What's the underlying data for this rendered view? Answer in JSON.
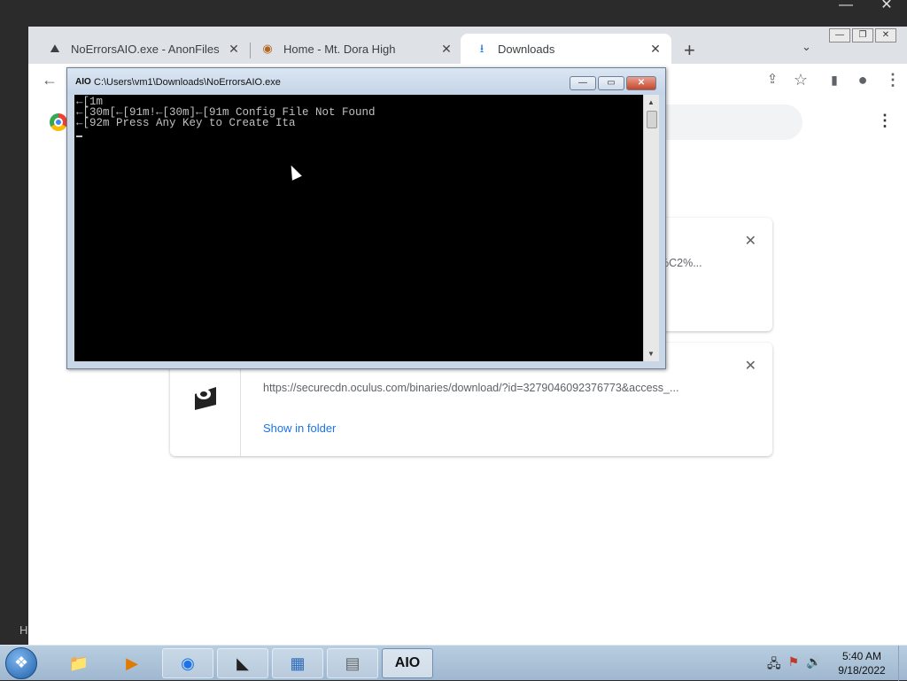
{
  "desktop": {
    "outer_minimize": "—",
    "outer_close": "✕",
    "edge_letter": "H"
  },
  "browser": {
    "tabs": [
      {
        "title": "NoErrorsAIO.exe - AnonFiles",
        "icon": "anonfiles-icon",
        "close": "✕"
      },
      {
        "title": "Home - Mt. Dora High",
        "icon": "mtdora-icon",
        "close": "✕"
      },
      {
        "title": "Downloads",
        "icon": "download-icon",
        "close": "✕"
      }
    ],
    "new_tab": "+",
    "tab_search": "⌄",
    "window_controls": {
      "minimize": "—",
      "restore": "❐",
      "close": "✕"
    },
    "toolbar": {
      "back": "←",
      "share": "⇪",
      "bookmark": "☆",
      "sidebar": "▮",
      "profile": "●",
      "menu": "⋮"
    },
    "downloads_menu": "⋮"
  },
  "downloads": [
    {
      "url": "%C2%...",
      "close": "✕"
    },
    {
      "url": "https://securecdn.oculus.com/binaries/download/?id=3279046092376773&access_...",
      "show_in_folder": "Show in folder",
      "close": "✕"
    }
  ],
  "console": {
    "icon_label": "AIO",
    "title": "C:\\Users\\vm1\\Downloads\\NoErrorsAIO.exe",
    "controls": {
      "minimize": "—",
      "maximize": "▭",
      "close": "✕"
    },
    "lines": [
      "←[1m",
      "←[30m[←[91m!←[30m]←[91m Config File Not Found",
      "←[92m Press Any Key to Create Ita"
    ]
  },
  "taskbar": {
    "start_glyph": "❖",
    "apps": [
      {
        "name": "explorer",
        "glyph": "📁"
      },
      {
        "name": "media-player",
        "glyph": "▶"
      },
      {
        "name": "chrome",
        "glyph": "◉"
      },
      {
        "name": "oculus",
        "glyph": "◣"
      },
      {
        "name": "control-panel",
        "glyph": "▦"
      },
      {
        "name": "firewall",
        "glyph": "▤"
      },
      {
        "name": "aio",
        "glyph": "AIO"
      }
    ],
    "time": "5:40 AM",
    "date": "9/18/2022"
  }
}
